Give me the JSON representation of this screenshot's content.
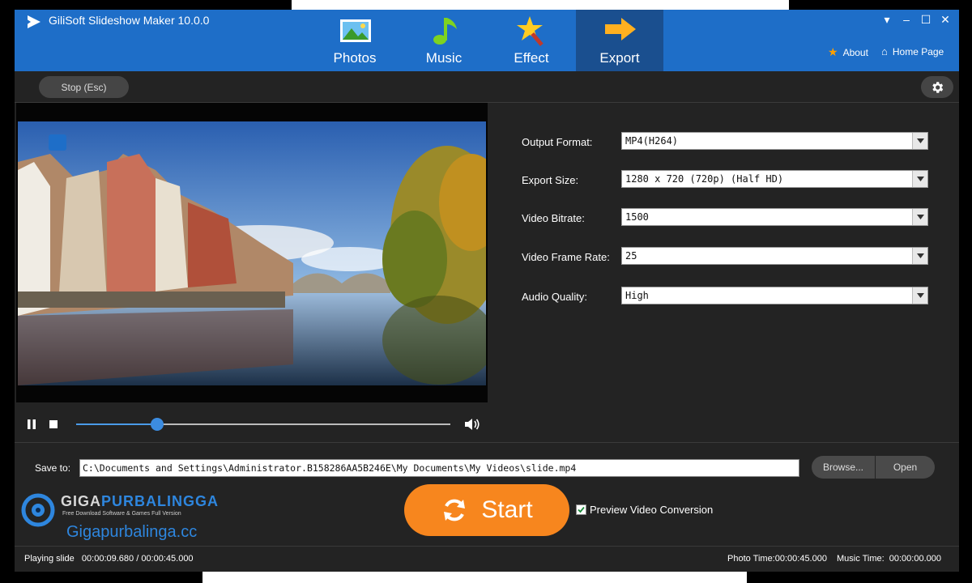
{
  "app": {
    "title": "GiliSoft Slideshow Maker 10.0.0"
  },
  "nav": {
    "tabs": [
      {
        "label": "Photos",
        "icon": "photos-icon"
      },
      {
        "label": "Music",
        "icon": "music-note-icon"
      },
      {
        "label": "Effect",
        "icon": "magic-star-icon"
      },
      {
        "label": "Export",
        "icon": "arrow-right-icon",
        "active": true
      }
    ]
  },
  "top_links": {
    "about": "About",
    "home_page": "Home Page"
  },
  "toolbar": {
    "stop_label": "Stop (Esc)"
  },
  "player": {
    "progress": 0.217,
    "playing": true
  },
  "settings": {
    "output_format": {
      "label": "Output Format:",
      "value": "MP4(H264)"
    },
    "export_size": {
      "label": "Export Size:",
      "value": "1280 x 720 (720p) (Half HD)"
    },
    "video_bitrate": {
      "label": "Video Bitrate:",
      "value": "1500"
    },
    "frame_rate": {
      "label": "Video Frame Rate:",
      "value": "25"
    },
    "audio_quality": {
      "label": "Audio Quality:",
      "value": "High"
    }
  },
  "save": {
    "label": "Save to:",
    "path": "C:\\Documents and Settings\\Administrator.B158286AA5B246E\\My Documents\\My Videos\\slide.mp4",
    "browse_label": "Browse...",
    "open_label": "Open"
  },
  "start": {
    "label": "Start"
  },
  "preview": {
    "label": "Preview Video Conversion",
    "checked": true
  },
  "watermark": {
    "name_part1": "GIGA",
    "name_part2": "PURBALINGGA",
    "tagline": "Free Download Software & Games Full Version",
    "url": "Gigapurbalinga.cc"
  },
  "status": {
    "playing": "Playing slide   00:00:09.680 / 00:00:45.000",
    "photo_time": "Photo Time:00:00:45.000",
    "music_time": "Music Time:  00:00:00.000"
  },
  "colors": {
    "titlebar": "#1e6ec8",
    "active_tab": "#1a4f8f",
    "start": "#f7861e",
    "accent": "#3c8ce0"
  }
}
